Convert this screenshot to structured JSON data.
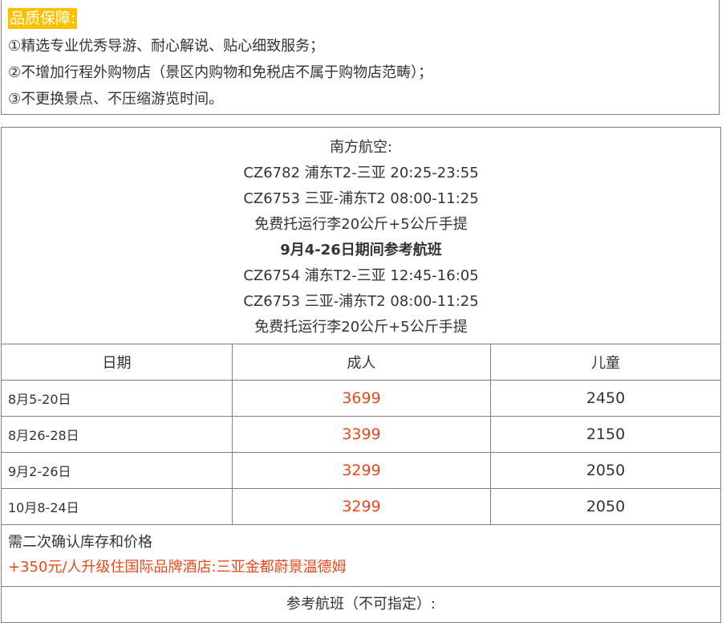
{
  "guarantee": {
    "title": "品质保障:",
    "items": [
      "①精选专业优秀导游、耐心解说、贴心细致服务；",
      "②不增加行程外购物店（景区内购物和免税店不属于购物店范畴）；",
      "③不更换景点、不压缩游览时间。"
    ]
  },
  "flights": {
    "airline": "南方航空:",
    "line1": "CZ6782 浦东T2-三亚 20:25-23:55",
    "line2": "CZ6753 三亚-浦东T2 08:00-11:25",
    "baggage1": "免费托运行李20公斤+5公斤手提",
    "period": "9月4-26日期间参考航班",
    "line3": "CZ6754 浦东T2-三亚 12:45-16:05",
    "line4": "CZ6753 三亚-浦东T2 08:00-11:25",
    "baggage2": "免费托运行李20公斤+5公斤手提"
  },
  "price_table": {
    "headers": [
      "日期",
      "成人",
      "儿童"
    ],
    "rows": [
      {
        "date": "8月5-20日",
        "adult": "3699",
        "child": "2450"
      },
      {
        "date": "8月26-28日",
        "adult": "3399",
        "child": "2150"
      },
      {
        "date": "9月2-26日",
        "adult": "3299",
        "child": "2050"
      },
      {
        "date": "10月8-24日",
        "adult": "3299",
        "child": "2050"
      }
    ]
  },
  "notes": {
    "confirm": "需二次确认库存和价格",
    "upgrade": "+350元/人升级住国际品牌酒店:三亚金都蔚景温德姆"
  },
  "reference": "参考航班（不可指定）:",
  "colors": {
    "accent_yellow": "#ffc000",
    "price_red": "#e8481c",
    "border": "#7f7f7f"
  }
}
